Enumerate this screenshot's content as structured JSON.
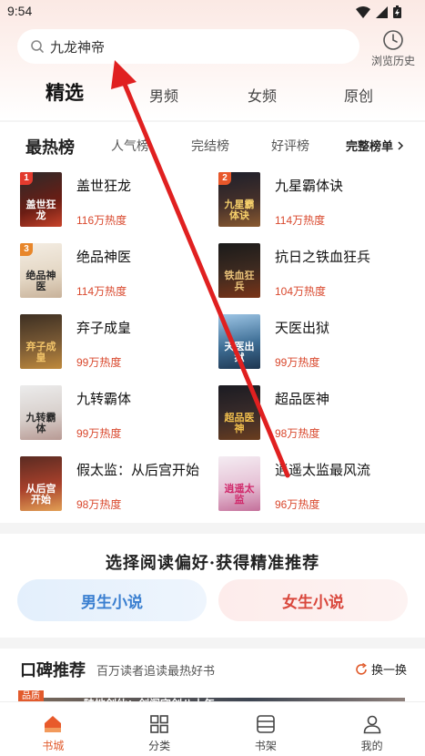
{
  "status_bar": {
    "time": "9:54"
  },
  "search": {
    "text": "九龙神帝"
  },
  "history": {
    "label": "浏览历史"
  },
  "main_tabs": [
    {
      "label": "精选",
      "active": true
    },
    {
      "label": "男频",
      "active": false
    },
    {
      "label": "女频",
      "active": false
    },
    {
      "label": "原创",
      "active": false
    }
  ],
  "ranking": {
    "tabs": [
      {
        "label": "最热榜",
        "active": true
      },
      {
        "label": "人气榜",
        "active": false
      },
      {
        "label": "完结榜",
        "active": false
      },
      {
        "label": "好评榜",
        "active": false
      }
    ],
    "full_list_label": "完整榜单",
    "books": [
      {
        "rank": "1",
        "title": "盖世狂龙",
        "heat": "116万热度",
        "cover_text": "盖世狂龙"
      },
      {
        "rank": "2",
        "title": "九星霸体诀",
        "heat": "114万热度",
        "cover_text": "九星霸体诀"
      },
      {
        "rank": "3",
        "title": "绝品神医",
        "heat": "114万热度",
        "cover_text": "绝品神医"
      },
      {
        "rank": "",
        "title": "抗日之铁血狂兵",
        "heat": "104万热度",
        "cover_text": "铁血狂兵"
      },
      {
        "rank": "",
        "title": "弃子成皇",
        "heat": "99万热度",
        "cover_text": "弃子成皇"
      },
      {
        "rank": "",
        "title": "天医出狱",
        "heat": "99万热度",
        "cover_text": "天医出狱"
      },
      {
        "rank": "",
        "title": "九转霸体",
        "heat": "99万热度",
        "cover_text": "九转霸体"
      },
      {
        "rank": "",
        "title": "超品医神",
        "heat": "98万热度",
        "cover_text": "超品医神"
      },
      {
        "rank": "",
        "title": "假太监：从后宫开始",
        "heat": "98万热度",
        "cover_text": "从后宫开始"
      },
      {
        "rank": "",
        "title": "逍遥太监最风流",
        "heat": "96万热度",
        "cover_text": "逍遥太监"
      }
    ]
  },
  "preference": {
    "title": "选择阅读偏好·获得精准推荐",
    "male_label": "男生小说",
    "female_label": "女生小说"
  },
  "koubei": {
    "title": "口碑推荐",
    "subtitle": "百万读者追读最热好书",
    "refresh_label": "换一换",
    "badge": "品质",
    "peek_text": "陆地剑仙：剑阁守剑八十年"
  },
  "bottom_nav": [
    {
      "label": "书城",
      "active": true
    },
    {
      "label": "分类",
      "active": false
    },
    {
      "label": "书架",
      "active": false
    },
    {
      "label": "我的",
      "active": false
    }
  ],
  "colors": {
    "accent": "#e05a2b",
    "heat": "#d9482d",
    "annotation_arrow": "#e02020"
  }
}
